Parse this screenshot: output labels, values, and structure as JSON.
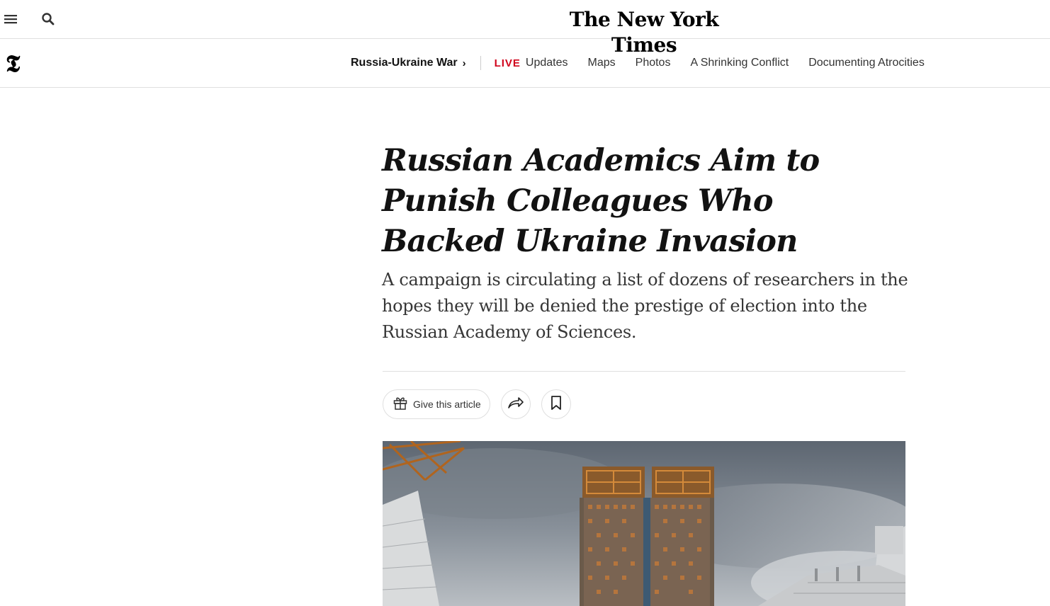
{
  "masthead": {
    "logo": "The New York Times",
    "icons": {
      "menu": "hamburger-menu-icon",
      "search": "search-icon"
    }
  },
  "section_nav": {
    "logo_glyph": "𝕿",
    "section": "Russia-Ukraine War",
    "chevron": "›",
    "live_tag": "LIVE",
    "live_label": "Updates",
    "links": [
      "Maps",
      "Photos",
      "A Shrinking Conflict",
      "Documenting Atrocities"
    ]
  },
  "article": {
    "headline": "Russian Academics Aim to Punish Colleagues Who Backed Ukraine Invasion",
    "summary": "A campaign is circulating a list of dozens of researchers in the hopes they will be denied the prestige of election into the Russian Academy of Sciences.",
    "share_tools": {
      "gift_label": "Give this article",
      "icons": {
        "gift": "gift-icon",
        "share": "share-arrow-icon",
        "save": "bookmark-icon"
      }
    }
  },
  "colors": {
    "live_red": "#d0021b",
    "rule_gray": "#dfdfdf",
    "text": "#121212"
  }
}
